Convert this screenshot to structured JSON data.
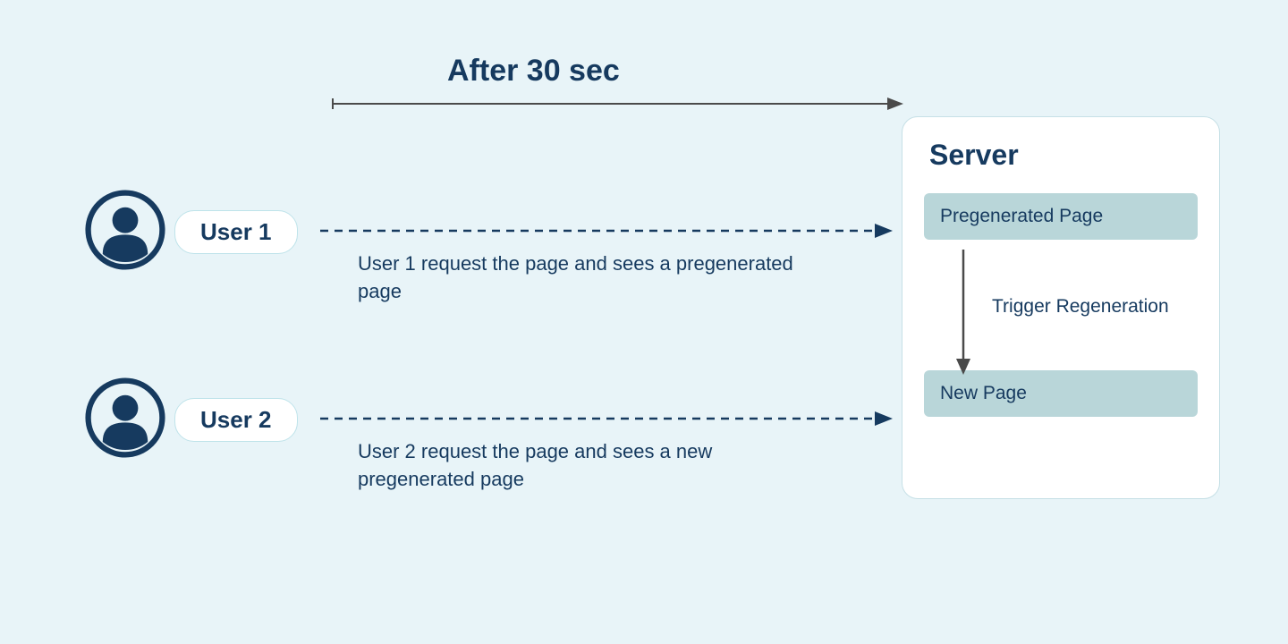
{
  "timeline": {
    "label": "After 30 sec"
  },
  "users": [
    {
      "label": "User 1",
      "caption": "User 1 request the page and sees a pregenerated page"
    },
    {
      "label": "User 2",
      "caption": "User 2 request the page and sees a new pregenerated page"
    }
  ],
  "server": {
    "title": "Server",
    "page_pregenerated": "Pregenerated Page",
    "page_new": "New Page",
    "regen_label": "Trigger Regeneration"
  },
  "colors": {
    "bg": "#e8f4f8",
    "ink": "#163a5f",
    "box": "#b9d6d9",
    "panel_border": "#c6e0e6",
    "arrow": "#4a4a4a"
  }
}
